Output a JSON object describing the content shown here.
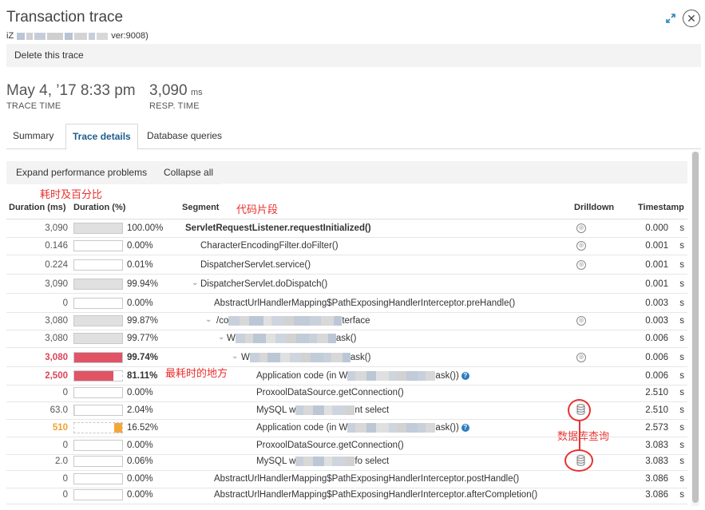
{
  "header": {
    "title": "Transaction trace",
    "host_prefix": "iZ",
    "host_suffix": "ver:9008)"
  },
  "toolbar": {
    "delete_label": "Delete this trace"
  },
  "metrics": {
    "trace_time_value": "May 4, ’17 8:33 pm",
    "trace_time_label": "TRACE TIME",
    "resp_time_value": "3,090",
    "resp_time_unit": "ms",
    "resp_time_label": "RESP. TIME"
  },
  "tabs": [
    {
      "label": "Summary"
    },
    {
      "label": "Trace details",
      "active": true
    },
    {
      "label": "Database queries"
    }
  ],
  "actions": {
    "expand_label": "Expand performance problems",
    "collapse_label": "Collapse all"
  },
  "annotations": {
    "duration_note": "耗时及百分比",
    "segment_note": "代码片段",
    "slowest_note": "最耗时的地方",
    "db_note": "数据库查询"
  },
  "columns": {
    "duration_ms": "Duration (ms)",
    "duration_pct": "Duration (%)",
    "segment": "Segment",
    "drilldown": "Drilldown",
    "timestamp": "Timestamp"
  },
  "rows": [
    {
      "dur": "3,090",
      "pct": "100.00%",
      "pct_val": 100,
      "seg": "ServletRequestListener.requestInitialized()",
      "ts": "0.000",
      "unit": "s"
    },
    {
      "dur": "0.146",
      "pct": "0.00%",
      "pct_val": 0,
      "seg": "CharacterEncodingFilter.doFilter()",
      "ts": "0.001",
      "unit": "s"
    },
    {
      "dur": "0.224",
      "pct": "0.01%",
      "pct_val": 0.01,
      "seg": "DispatcherServlet.service()",
      "ts": "0.001",
      "unit": "s"
    },
    {
      "dur": "3,090",
      "pct": "99.94%",
      "pct_val": 99.94,
      "seg": "DispatcherServlet.doDispatch()",
      "ts": "0.001",
      "unit": "s"
    },
    {
      "dur": "0",
      "pct": "0.00%",
      "pct_val": 0,
      "seg": "AbstractUrlHandlerMapping$PathExposingHandlerInterceptor.preHandle()",
      "ts": "0.003",
      "unit": "s"
    },
    {
      "dur": "3,080",
      "pct": "99.87%",
      "pct_val": 99.87,
      "seg_a": "/co",
      "seg_b": "terface",
      "ts": "0.003",
      "unit": "s"
    },
    {
      "dur": "3,080",
      "pct": "99.77%",
      "pct_val": 99.77,
      "seg_a": "W",
      "seg_b": "ask()",
      "ts": "0.006",
      "unit": "s"
    },
    {
      "dur": "3,080",
      "pct": "99.74%",
      "pct_val": 99.74,
      "seg_a": "W",
      "seg_b": "ask()",
      "ts": "0.006",
      "unit": "s"
    },
    {
      "dur": "2,500",
      "pct": "81.11%",
      "pct_val": 81.11,
      "seg_a": "Application code (in W",
      "seg_b": "ask())",
      "ts": "0.006",
      "unit": "s"
    },
    {
      "dur": "0",
      "pct": "0.00%",
      "pct_val": 0,
      "seg": "ProxoolDataSource.getConnection()",
      "ts": "2.510",
      "unit": "s"
    },
    {
      "dur": "63.0",
      "pct": "2.04%",
      "pct_val": 2.04,
      "seg_a": "MySQL w",
      "seg_b": "nt select",
      "ts": "2.510",
      "unit": "s"
    },
    {
      "dur": "510",
      "pct": "16.52%",
      "pct_val": 16.52,
      "seg_a": "Application code (in W",
      "seg_b": "ask())",
      "ts": "2.573",
      "unit": "s"
    },
    {
      "dur": "0",
      "pct": "0.00%",
      "pct_val": 0,
      "seg": "ProxoolDataSource.getConnection()",
      "ts": "3.083",
      "unit": "s"
    },
    {
      "dur": "2.0",
      "pct": "0.06%",
      "pct_val": 0.06,
      "seg_a": "MySQL w",
      "seg_b": "fo select",
      "ts": "3.083",
      "unit": "s"
    },
    {
      "dur": "0",
      "pct": "0.00%",
      "pct_val": 0,
      "seg": "AbstractUrlHandlerMapping$PathExposingHandlerInterceptor.postHandle()",
      "ts": "3.086",
      "unit": "s"
    },
    {
      "dur": "0",
      "pct": "0.00%",
      "pct_val": 0,
      "seg": "AbstractUrlHandlerMapping$PathExposingHandlerInterceptor.afterCompletion()",
      "ts": "3.086",
      "unit": "s"
    }
  ],
  "colors": {
    "slow": "#e05466",
    "warn": "#f3a73b",
    "link": "#1d5d8e",
    "annotation": "#e8312e"
  },
  "icons": {
    "drilldown": "magnifier-icon",
    "database": "database-icon",
    "help": "help-icon"
  }
}
